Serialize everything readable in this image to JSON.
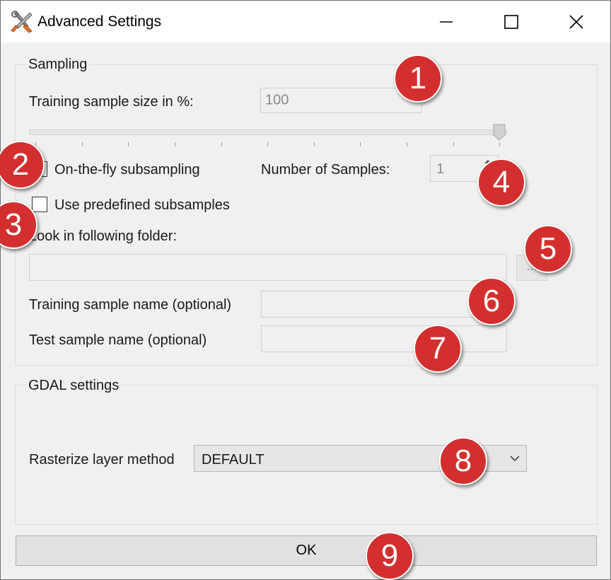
{
  "window": {
    "title": "Advanced Settings",
    "controls": [
      "minimize",
      "maximize",
      "close"
    ]
  },
  "sampling": {
    "group_title": "Sampling",
    "training_size_label": "Training sample size in %:",
    "training_size_value": "100",
    "slider_value_percent": 100,
    "on_the_fly_label": "On-the-fly subsampling",
    "on_the_fly_checked": false,
    "num_samples_label": "Number of Samples:",
    "num_samples_value": "1",
    "predefined_label": "Use predefined subsamples",
    "predefined_checked": false,
    "folder_label": "Look in following folder:",
    "folder_value": "",
    "browse_label": "...",
    "train_name_label": "Training sample name (optional)",
    "train_name_value": "",
    "test_name_label": "Test sample name (optional)",
    "test_name_value": ""
  },
  "gdal": {
    "group_title": "GDAL settings",
    "rasterize_label": "Rasterize layer method",
    "rasterize_value": "DEFAULT"
  },
  "ok_label": "OK",
  "annotations": [
    "1",
    "2",
    "3",
    "4",
    "5",
    "6",
    "7",
    "8",
    "9"
  ],
  "colors": {
    "badge": "#d32f2f",
    "window_bg": "#f0f0f0",
    "titlebar_bg": "#ffffff"
  }
}
